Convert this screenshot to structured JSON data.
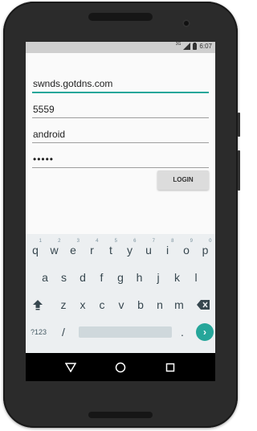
{
  "form": {
    "host": "swnds.gotdns.com",
    "port": "5559",
    "username": "android",
    "password": "•••••"
  },
  "login_button": "LOGIN",
  "statusbar": {
    "network": "3G",
    "time": "6:07"
  },
  "keyboard": {
    "row1": [
      {
        "key": "q",
        "hint": "1"
      },
      {
        "key": "w",
        "hint": "2"
      },
      {
        "key": "e",
        "hint": "3"
      },
      {
        "key": "r",
        "hint": "4"
      },
      {
        "key": "t",
        "hint": "5"
      },
      {
        "key": "y",
        "hint": "6"
      },
      {
        "key": "u",
        "hint": "7"
      },
      {
        "key": "i",
        "hint": "8"
      },
      {
        "key": "o",
        "hint": "9"
      },
      {
        "key": "p",
        "hint": "0"
      }
    ],
    "row2": [
      "a",
      "s",
      "d",
      "f",
      "g",
      "h",
      "j",
      "k",
      "l"
    ],
    "row3": [
      "z",
      "x",
      "c",
      "v",
      "b",
      "n",
      "m"
    ],
    "symbols_key": "?123",
    "slash_key": "/",
    "period_key": ".",
    "shift_icon": "shift-arrow-icon",
    "backspace_icon": "backspace-icon",
    "go_icon": "chevron-right-icon"
  },
  "navbar": {
    "back_icon": "back-triangle-icon",
    "home_icon": "home-circle-icon",
    "recents_icon": "recents-square-icon"
  },
  "colors": {
    "accent": "#26a69a",
    "keyboard_bg": "#eceff1",
    "statusbar": "#cfcfcf"
  }
}
